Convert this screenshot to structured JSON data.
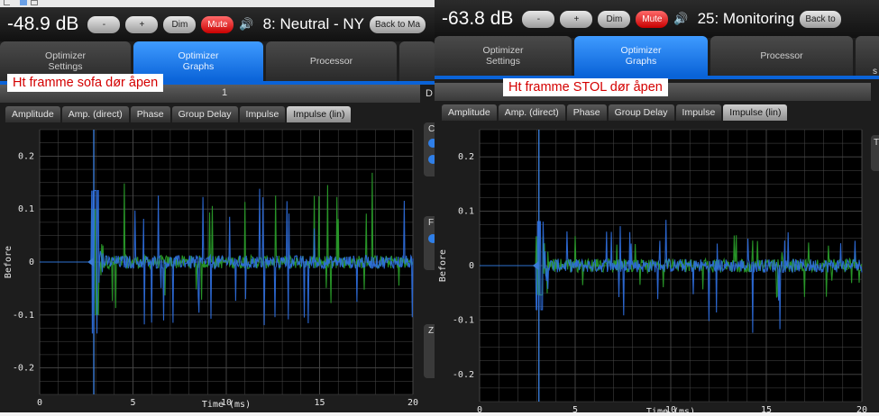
{
  "window": {
    "top_strip_icons": [
      "arrow-icon",
      "arrow-icon",
      "cursor-icon",
      "box-icon"
    ]
  },
  "panels": [
    {
      "volume": "-48.9 dB",
      "minus_label": "-",
      "plus_label": "+",
      "dim_label": "Dim",
      "mute_label": "Mute",
      "speaker_icon": "speaker-icon",
      "preset": "8: Neutral - NY",
      "back_label": "Back to Ma",
      "tabs": [
        {
          "line1": "Optimizer",
          "line2": "Settings"
        },
        {
          "line1": "Optimizer",
          "line2": "Graphs"
        },
        {
          "line1": "Processor",
          "line2": ""
        }
      ],
      "note": "Ht framme sofa dør åpen",
      "subbar_text": "1",
      "graph_tabs": [
        "Amplitude",
        "Amp. (direct)",
        "Phase",
        "Group Delay",
        "Impulse",
        "Impulse (lin)"
      ],
      "active_graph_tab": 5,
      "side_letters": [
        "D",
        "C",
        "F",
        "Z"
      ]
    },
    {
      "volume": "-63.8 dB",
      "minus_label": "-",
      "plus_label": "+",
      "dim_label": "Dim",
      "mute_label": "Mute",
      "speaker_icon": "speaker-icon",
      "preset": "25: Monitoring",
      "back_label": "Back to",
      "tabs": [
        {
          "line1": "Optimizer",
          "line2": "Settings"
        },
        {
          "line1": "Optimizer",
          "line2": "Graphs"
        },
        {
          "line1": "Processor",
          "line2": ""
        }
      ],
      "note": "Ht framme STOL dør åpen",
      "graph_tabs": [
        "Amplitude",
        "Amp. (direct)",
        "Phase",
        "Group Delay",
        "Impulse",
        "Impulse (lin)"
      ],
      "active_graph_tab": 5,
      "side_letters": [
        "s",
        "T"
      ]
    }
  ],
  "chart_data": [
    {
      "type": "line",
      "xlabel": "Time (ms)",
      "ylabel": "Before",
      "xlim": [
        0,
        20
      ],
      "ylim": [
        -0.25,
        0.25
      ],
      "x_ticks": [
        "0",
        "5",
        "10",
        "15",
        "20"
      ],
      "y_ticks": [
        "0.2",
        "0.1",
        "0",
        "-0.1",
        "-0.2"
      ],
      "colors": {
        "background": "#000000",
        "grid": "#4a4a4a",
        "series_a": "#2aa02a",
        "series_b": "#2f6fe0",
        "marker": "#3a7bd5"
      },
      "impulse_time_ms": 2.9,
      "series": [
        {
          "color_key": "series_a",
          "peak_positive": 0.18,
          "peak_negative": -0.11
        },
        {
          "color_key": "series_b",
          "peak_positive": 0.15,
          "peak_negative": -0.12
        }
      ]
    },
    {
      "type": "line",
      "xlabel": "Time (ms)",
      "ylabel": "Before",
      "xlim": [
        0,
        20
      ],
      "ylim": [
        -0.25,
        0.25
      ],
      "x_ticks": [
        "0",
        "5",
        "10",
        "15",
        "20"
      ],
      "y_ticks": [
        "0.2",
        "0.1",
        "0",
        "-0.1",
        "-0.2"
      ],
      "colors": {
        "background": "#000000",
        "grid": "#4a4a4a",
        "series_a": "#2aa02a",
        "series_b": "#2f6fe0",
        "marker": "#3a7bd5"
      },
      "impulse_time_ms": 3.1,
      "series": [
        {
          "color_key": "series_a",
          "peak_positive": 0.06,
          "peak_negative": -0.06
        },
        {
          "color_key": "series_b",
          "peak_positive": 0.09,
          "peak_negative": -0.13
        }
      ]
    }
  ]
}
